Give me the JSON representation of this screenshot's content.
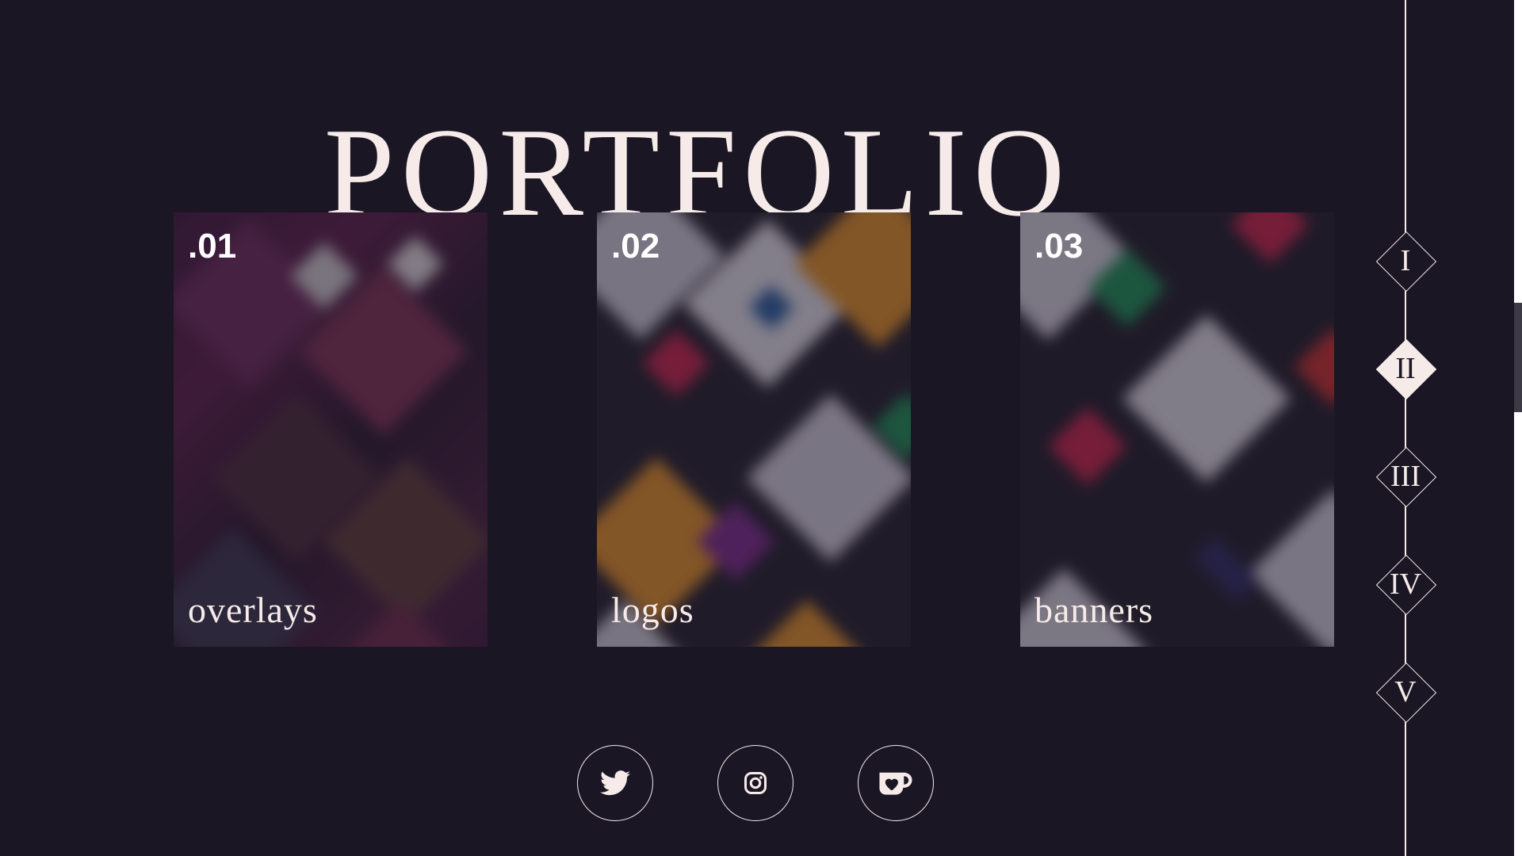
{
  "page": {
    "title": "PORTFOLIO"
  },
  "cards": [
    {
      "number": ".01",
      "label": "overlays"
    },
    {
      "number": ".02",
      "label": "logos"
    },
    {
      "number": ".03",
      "label": "banners"
    }
  ],
  "socials": [
    {
      "icon": "twitter-icon"
    },
    {
      "icon": "instagram-icon"
    },
    {
      "icon": "ko-fi-icon"
    }
  ],
  "nav": {
    "items": [
      "I",
      "II",
      "III",
      "IV",
      "V"
    ],
    "active_index": 1
  },
  "colors": {
    "background": "#1a1624",
    "foreground": "#f6ebe8"
  }
}
